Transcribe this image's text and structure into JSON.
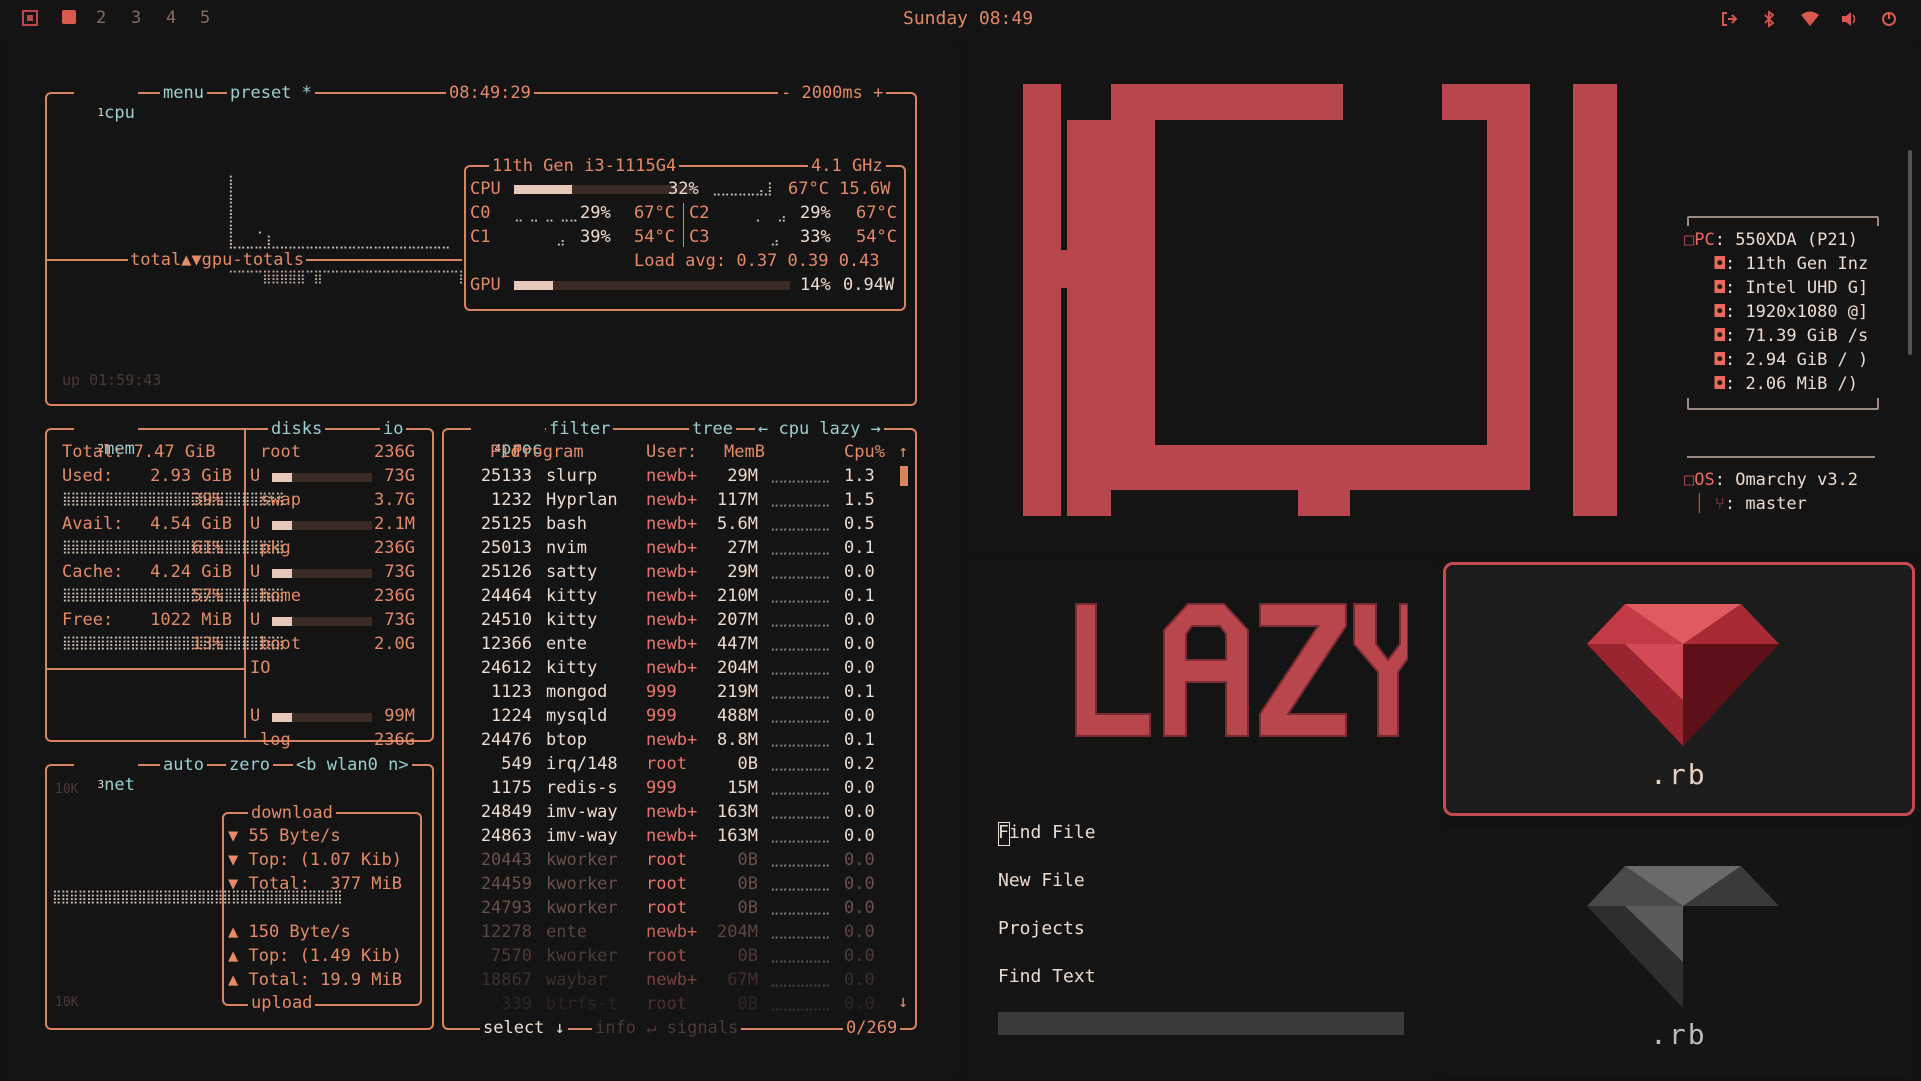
{
  "topbar": {
    "workspaces": [
      "2",
      "3",
      "4",
      "5"
    ],
    "clock": "Sunday 08:49",
    "icons": [
      "logout-icon",
      "bluetooth-icon",
      "wifi-icon",
      "volume-icon",
      "power-icon"
    ]
  },
  "cpu": {
    "num": "1",
    "title": "cpu",
    "menu": "menu",
    "preset": "preset *",
    "time": "08:49:29",
    "interval": "- 2000ms +",
    "graph_label": "total▲▼gpu-totals",
    "uptime": "up 01:59:43",
    "model": "11th Gen i3-1115G4",
    "freq": "4.1 GHz",
    "cpu_label": "CPU",
    "cpu_pct": "32%",
    "cpu_pct_value": 32,
    "cpu_temp": "67°C 15.6W",
    "cores": [
      {
        "l": "C0",
        "p": "29%",
        "t": "67°C",
        "r": "C2",
        "rp": "29%",
        "rt": "67°C"
      },
      {
        "l": "C1",
        "p": "39%",
        "t": "54°C",
        "r": "C3",
        "rp": "33%",
        "rt": "54°C"
      }
    ],
    "load": "Load avg: 0.37 0.39 0.43",
    "gpu_label": "GPU",
    "gpu_pct": "14%",
    "gpu_pct_value": 14,
    "gpu_w": "0.94W"
  },
  "mem": {
    "num": "2",
    "title": "mem",
    "disks": "disks",
    "io": "io",
    "total": "Total: 7.47 GiB",
    "rows": [
      {
        "k": "Used:",
        "v": "2.93 GiB",
        "pct": "39%"
      },
      {
        "k": "Avail:",
        "v": "4.54 GiB",
        "pct": "61%"
      },
      {
        "k": "Cache:",
        "v": "4.24 GiB",
        "pct": "57%"
      },
      {
        "k": "Free:",
        "v": "1022 MiB",
        "pct": "13%"
      }
    ],
    "disk_rows": [
      {
        "n": "root",
        "s": "236G",
        "u": "U",
        "f": "73G"
      },
      {
        "n": "swap",
        "s": "3.7G",
        "u": "U",
        "f": "2.1M"
      },
      {
        "n": "pkg",
        "s": "236G",
        "u": "U",
        "f": "73G"
      },
      {
        "n": "home",
        "s": "236G",
        "u": "U",
        "f": "73G"
      },
      {
        "n": "boot",
        "s": "2.0G",
        "u": "IO",
        "f": ""
      },
      {
        "n": "",
        "s": "",
        "u": "U",
        "f": "99M"
      },
      {
        "n": "log",
        "s": "236G",
        "u": "",
        "f": ""
      }
    ]
  },
  "net": {
    "num": "3",
    "title": "net",
    "auto": "auto",
    "zero": "zero",
    "iface": "<b wlan0 n>",
    "top_scale": "10K",
    "bottom_scale": "10K",
    "download": "download",
    "upload": "upload",
    "down": [
      "▼ 55 Byte/s",
      "▼ Top: (1.07 Kib)",
      "▼ Total:  377 MiB"
    ],
    "up": [
      "▲ 150 Byte/s",
      "▲ Top: (1.49 Kib)",
      "▲ Total: 19.9 MiB"
    ]
  },
  "proc": {
    "num": "4",
    "title": "proc",
    "filter": "filter",
    "tree": "tree",
    "sort": "← cpu lazy →",
    "headers": [
      "Pid:",
      "Program",
      "User:",
      "MemB",
      "Cpu%"
    ],
    "rows": [
      [
        "25133",
        "slurp",
        "newb+",
        "29M",
        "1.3"
      ],
      [
        "1232",
        "Hyprlan",
        "newb+",
        "117M",
        "1.5"
      ],
      [
        "25125",
        "bash",
        "newb+",
        "5.6M",
        "0.5"
      ],
      [
        "25013",
        "nvim",
        "newb+",
        "27M",
        "0.1"
      ],
      [
        "25126",
        "satty",
        "newb+",
        "29M",
        "0.0"
      ],
      [
        "24464",
        "kitty",
        "newb+",
        "210M",
        "0.1"
      ],
      [
        "24510",
        "kitty",
        "newb+",
        "207M",
        "0.0"
      ],
      [
        "12366",
        "ente",
        "newb+",
        "447M",
        "0.0"
      ],
      [
        "24612",
        "kitty",
        "newb+",
        "204M",
        "0.0"
      ],
      [
        "1123",
        "mongod",
        "999",
        "219M",
        "0.1"
      ],
      [
        "1224",
        "mysqld",
        "999",
        "488M",
        "0.0"
      ],
      [
        "24476",
        "btop",
        "newb+",
        "8.8M",
        "0.1"
      ],
      [
        "549",
        "irq/148",
        "root",
        "0B",
        "0.2"
      ],
      [
        "1175",
        "redis-s",
        "999",
        "15M",
        "0.0"
      ],
      [
        "24849",
        "imv-way",
        "newb+",
        "163M",
        "0.0"
      ],
      [
        "24863",
        "imv-way",
        "newb+",
        "163M",
        "0.0"
      ],
      [
        "20443",
        "kworker",
        "root",
        "0B",
        "0.0"
      ],
      [
        "24459",
        "kworker",
        "root",
        "0B",
        "0.0"
      ],
      [
        "24793",
        "kworker",
        "root",
        "0B",
        "0.0"
      ],
      [
        "12278",
        "ente",
        "newb+",
        "204M",
        "0.0"
      ],
      [
        "7570",
        "kworker",
        "root",
        "0B",
        "0.0"
      ],
      [
        "18867",
        "waybar",
        "newb+",
        "67M",
        "0.0"
      ],
      [
        "339",
        "btrfs-t",
        "root",
        "0B",
        "0.0"
      ]
    ],
    "footer_select": "select ↓",
    "footer_info": "info ↵ signals",
    "footer_count": "0/269"
  },
  "fetch": {
    "info": [
      {
        "k": "PC",
        "v": ": 550XDA (P21)"
      },
      {
        "k": "",
        "v": ": 11th Gen Inz"
      },
      {
        "k": "",
        "v": ": Intel UHD G]"
      },
      {
        "k": "",
        "v": ": 1920x1080 @]"
      },
      {
        "k": "",
        "v": ": 71.39 GiB /s"
      },
      {
        "k": "",
        "v": ": 2.94 GiB / )"
      },
      {
        "k": "",
        "v": ": 2.06 MiB /)"
      }
    ],
    "os": [
      {
        "k": "OS",
        "v": ": Omarchy v3.2"
      },
      {
        "k": "",
        "v": ": master"
      }
    ]
  },
  "nvim": {
    "menu": [
      "Find File",
      "New File",
      "Projects",
      "Find Text"
    ]
  },
  "tiles": {
    "label1": ".rb",
    "label2": ".rb"
  },
  "colors": {
    "accent": "#e48a66",
    "logo": "#b9454d",
    "border_active": "#c44a52"
  }
}
